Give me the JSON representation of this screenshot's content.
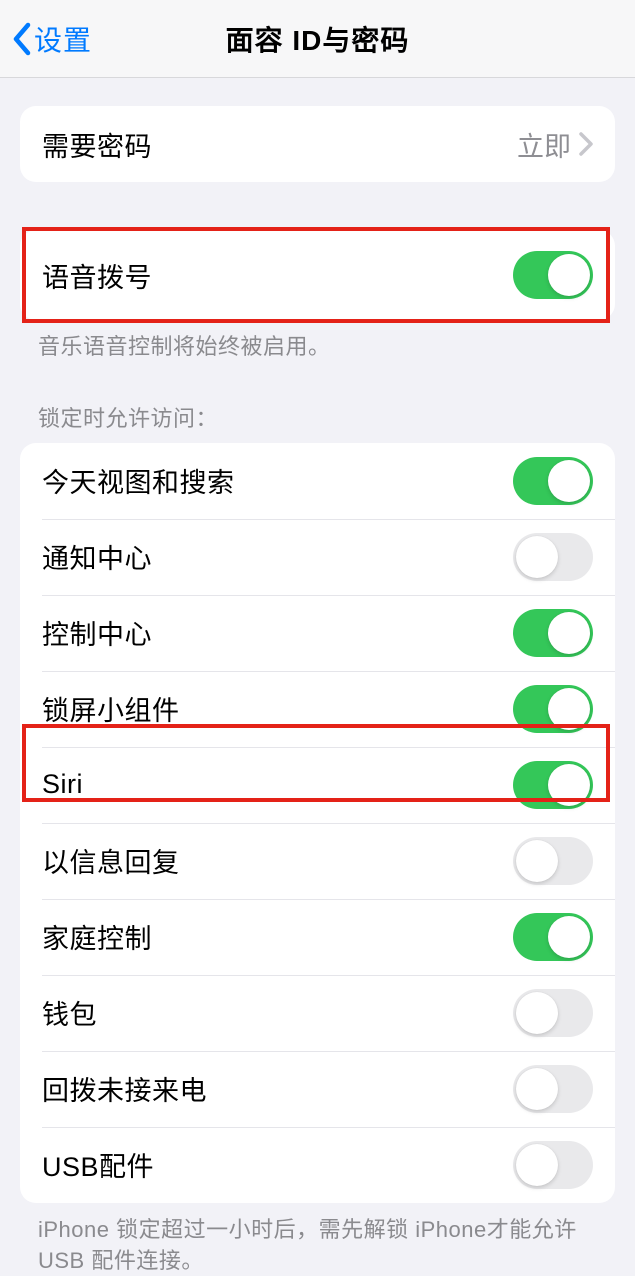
{
  "navbar": {
    "back_label": "设置",
    "title": "面容 ID与密码"
  },
  "passcode_section": {
    "label": "需要密码",
    "value": "立即"
  },
  "voice_dial": {
    "label": "语音拨号",
    "on": true,
    "footer": "音乐语音控制将始终被启用。"
  },
  "lock_access": {
    "header": "锁定时允许访问：",
    "items": [
      {
        "label": "今天视图和搜索",
        "on": true
      },
      {
        "label": "通知中心",
        "on": false
      },
      {
        "label": "控制中心",
        "on": true
      },
      {
        "label": "锁屏小组件",
        "on": true
      },
      {
        "label": "Siri",
        "on": true
      },
      {
        "label": "以信息回复",
        "on": false
      },
      {
        "label": "家庭控制",
        "on": true
      },
      {
        "label": "钱包",
        "on": false
      },
      {
        "label": "回拨未接来电",
        "on": false
      },
      {
        "label": "USB配件",
        "on": false
      }
    ],
    "footer": "iPhone 锁定超过一小时后，需先解锁 iPhone才能允许USB 配件连接。"
  }
}
